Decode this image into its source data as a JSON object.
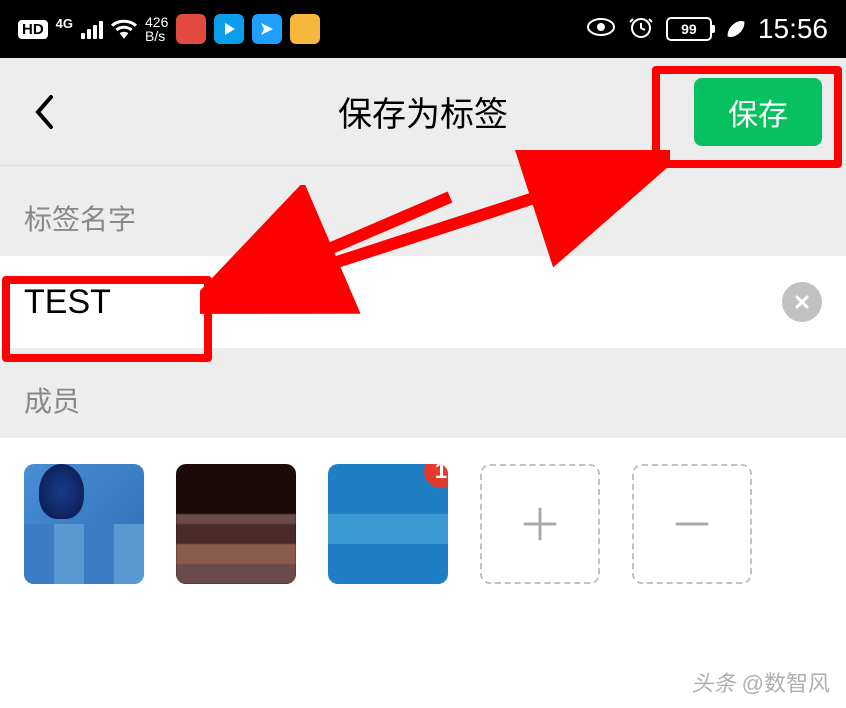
{
  "status_bar": {
    "hd": "HD",
    "net": "4G",
    "speed_value": "426",
    "speed_unit": "B/s",
    "battery": "99",
    "time": "15:56"
  },
  "header": {
    "title": "保存为标签",
    "save_label": "保存"
  },
  "tag_name_section": {
    "label": "标签名字",
    "input_value": "TEST"
  },
  "members_section": {
    "label": "成员",
    "badge_count": "1",
    "add_symbol": "+",
    "remove_symbol": "−"
  },
  "annotation": {
    "highlight_color": "#ff0000",
    "arrow_color": "#ff0000"
  },
  "watermark": {
    "prefix": "头条",
    "handle": "@数智风"
  }
}
